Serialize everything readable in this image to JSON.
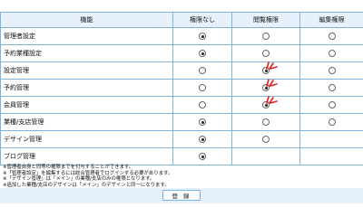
{
  "table": {
    "headers": [
      "機能",
      "権限なし",
      "閲覧権限",
      "編集権限"
    ],
    "rows": [
      {
        "label": "管理者設定",
        "selected": 0,
        "options": 3,
        "highlight": false
      },
      {
        "label": "予約業種設定",
        "selected": 0,
        "options": 3,
        "highlight": false
      },
      {
        "label": "設定管理",
        "selected": 1,
        "options": 3,
        "highlight": true
      },
      {
        "label": "予約管理",
        "selected": 1,
        "options": 3,
        "highlight": true
      },
      {
        "label": "会員管理",
        "selected": 1,
        "options": 3,
        "highlight": true
      },
      {
        "label": "業種/支店管理",
        "selected": 0,
        "options": 3,
        "highlight": false
      },
      {
        "label": "デザイン管理",
        "selected": 0,
        "options": 2,
        "highlight": false
      },
      {
        "label": "ブログ管理",
        "selected": 0,
        "options": 1,
        "highlight": false
      }
    ]
  },
  "notes": [
    "※管理者自身と同等の権限までを付与することができます。",
    "※「管理者設定」を編集するには総合管理者でログインする必要があります。",
    "※「デザイン管理」は「メイン」の業種/支店のみの権限となります。",
    "※追加した業種/支店のデザインは「メイン」のデザインと同一になります。"
  ],
  "submit_label": "登 録",
  "colors": {
    "border": "#7fb4e0",
    "header_bg": "#e6f1fb",
    "highlight_mark": "#e02020"
  }
}
